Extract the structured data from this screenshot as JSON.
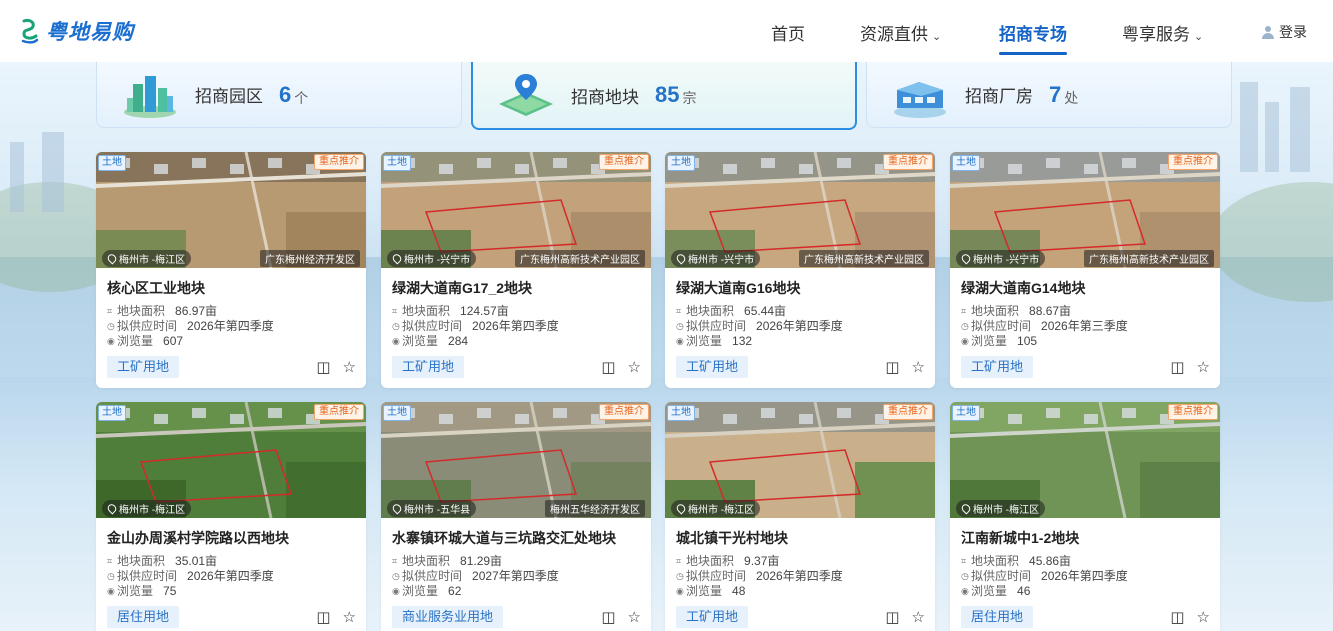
{
  "header": {
    "logo_text": "粤地易购",
    "nav": [
      {
        "label": "首页",
        "dropdown": false,
        "active": false
      },
      {
        "label": "资源直供",
        "dropdown": true,
        "active": false
      },
      {
        "label": "招商专场",
        "dropdown": false,
        "active": true
      },
      {
        "label": "粤享服务",
        "dropdown": true,
        "active": false
      }
    ],
    "login_label": "登录"
  },
  "categories": [
    {
      "label": "招商园区",
      "count": "6",
      "unit": "个",
      "icon": "buildings-icon",
      "active": false
    },
    {
      "label": "招商地块",
      "count": "85",
      "unit": "宗",
      "icon": "land-plot-icon",
      "active": true
    },
    {
      "label": "招商厂房",
      "count": "7",
      "unit": "处",
      "icon": "factory-icon",
      "active": false
    }
  ],
  "labels": {
    "land_tag": "土地",
    "featured_tag": "重点推介",
    "area_label": "地块面积",
    "supply_label": "拟供应时间",
    "views_label": "浏览量"
  },
  "cards": [
    {
      "title": "核心区工业地块",
      "location": "梅州市 -梅江区",
      "zone": "广东梅州经济开发区",
      "area": "86.97亩",
      "supply": "2026年第四季度",
      "views": "607",
      "type": "工矿用地"
    },
    {
      "title": "绿湖大道南G17_2地块",
      "location": "梅州市 -兴宁市",
      "zone": "广东梅州高新技术产业园区",
      "area": "124.57亩",
      "supply": "2026年第四季度",
      "views": "284",
      "type": "工矿用地"
    },
    {
      "title": "绿湖大道南G16地块",
      "location": "梅州市 -兴宁市",
      "zone": "广东梅州高新技术产业园区",
      "area": "65.44亩",
      "supply": "2026年第四季度",
      "views": "132",
      "type": "工矿用地"
    },
    {
      "title": "绿湖大道南G14地块",
      "location": "梅州市 -兴宁市",
      "zone": "广东梅州高新技术产业园区",
      "area": "88.67亩",
      "supply": "2026年第三季度",
      "views": "105",
      "type": "工矿用地"
    },
    {
      "title": "金山办周溪村学院路以西地块",
      "location": "梅州市 -梅江区",
      "zone": "",
      "area": "35.01亩",
      "supply": "2026年第四季度",
      "views": "75",
      "type": "居住用地"
    },
    {
      "title": "水寨镇环城大道与三坑路交汇处地块",
      "location": "梅州市 -五华县",
      "zone": "梅州五华经济开发区",
      "area": "81.29亩",
      "supply": "2027年第四季度",
      "views": "62",
      "type": "商业服务业用地"
    },
    {
      "title": "城北镇干光村地块",
      "location": "梅州市 -梅江区",
      "zone": "",
      "area": "9.37亩",
      "supply": "2026年第四季度",
      "views": "48",
      "type": "工矿用地"
    },
    {
      "title": "江南新城中1-2地块",
      "location": "梅州市 -梅江区",
      "zone": "",
      "area": "45.86亩",
      "supply": "2026年第四季度",
      "views": "46",
      "type": "居住用地"
    }
  ],
  "colors": {
    "brand": "#1463c7",
    "featured": "#e5651c",
    "tag_bg": "#e6f1fc"
  }
}
